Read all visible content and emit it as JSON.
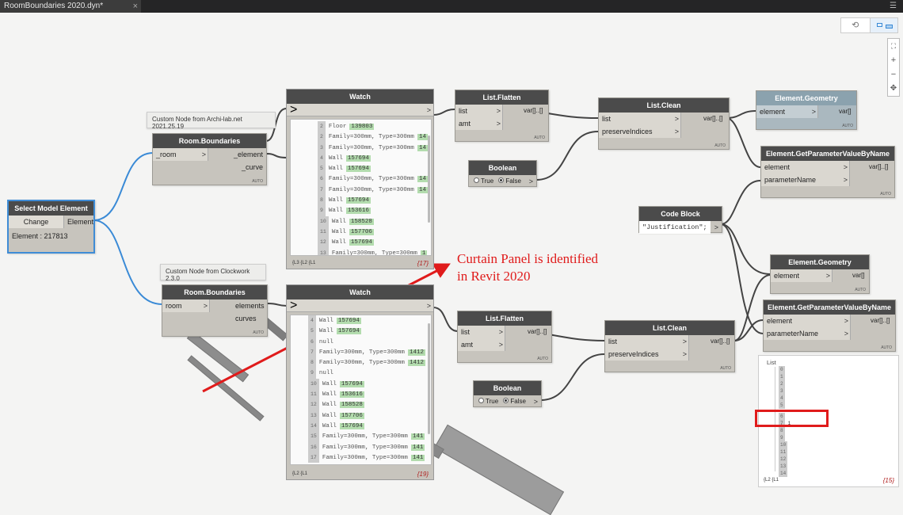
{
  "tab": {
    "title": "RoomBoundaries 2020.dyn*",
    "close": "×",
    "menu": "☰"
  },
  "controls": {
    "zoom_in": "+",
    "zoom_out": "−",
    "pan": "✥",
    "fit": "⛶",
    "geom_icon": "geometry-view-icon",
    "graph_icon": "graph-view-icon"
  },
  "tooltips": {
    "archilab": "Custom Node from Archi-lab.net 2021.25.19",
    "clockwork": "Custom Node from Clockwork 2.3.0"
  },
  "select_node": {
    "title": "Select Model Element",
    "change": "Change",
    "out": "Element",
    "value": "Element : 217813"
  },
  "rb1": {
    "title": "Room.Boundaries",
    "in": "_room",
    "out1": "_element",
    "out2": "_curve",
    "auto": "AUTO"
  },
  "rb2": {
    "title": "Room.Boundaries",
    "in": "room",
    "out1": "elements",
    "out2": "curves",
    "auto": "AUTO"
  },
  "watch1": {
    "title": "Watch",
    "in": ">",
    "out": ">",
    "footer": "{L3 {L2 {L1",
    "count": "{17}",
    "rows": [
      {
        "i": "2",
        "t": "Floor",
        "v": "139803"
      },
      {
        "i": "2",
        "t": "Family=300mm, Type=300mm",
        "v": "14"
      },
      {
        "i": "3",
        "t": "Family=300mm, Type=300mm",
        "v": "14"
      },
      {
        "i": "4",
        "t": "Wall",
        "v": "157694"
      },
      {
        "i": "5",
        "t": "Wall",
        "v": "157694"
      },
      {
        "i": "6",
        "t": "Family=300mm, Type=300mm",
        "v": "14"
      },
      {
        "i": "7",
        "t": "Family=300mm, Type=300mm",
        "v": "14"
      },
      {
        "i": "8",
        "t": "Wall",
        "v": "157694"
      },
      {
        "i": "9",
        "t": "Wall",
        "v": "153616"
      },
      {
        "i": "10",
        "t": "Wall",
        "v": "158528"
      },
      {
        "i": "11",
        "t": "Wall",
        "v": "157706"
      },
      {
        "i": "12",
        "t": "Wall",
        "v": "157694"
      },
      {
        "i": "13",
        "t": "Family=300mm, Type=300mm",
        "v": "1"
      }
    ]
  },
  "watch2": {
    "title": "Watch",
    "in": ">",
    "out": ">",
    "footer": "{L2 {L1",
    "count": "{19}",
    "rows": [
      {
        "i": "4",
        "t": "Wall",
        "v": "157694"
      },
      {
        "i": "5",
        "t": "Wall",
        "v": "157694"
      },
      {
        "i": "6",
        "t": "null",
        "v": ""
      },
      {
        "i": "7",
        "t": "Family=300mm, Type=300mm",
        "v": "1412"
      },
      {
        "i": "8",
        "t": "Family=300mm, Type=300mm",
        "v": "1412"
      },
      {
        "i": "9",
        "t": "null",
        "v": ""
      },
      {
        "i": "10",
        "t": "Wall",
        "v": "157694"
      },
      {
        "i": "11",
        "t": "Wall",
        "v": "153616"
      },
      {
        "i": "12",
        "t": "Wall",
        "v": "158528"
      },
      {
        "i": "13",
        "t": "Wall",
        "v": "157706"
      },
      {
        "i": "14",
        "t": "Wall",
        "v": "157694"
      },
      {
        "i": "15",
        "t": "Family=300mm, Type=300mm",
        "v": "141"
      },
      {
        "i": "16",
        "t": "Family=300mm, Type=300mm",
        "v": "141"
      },
      {
        "i": "17",
        "t": "Family=300mm, Type=300mm",
        "v": "141"
      }
    ]
  },
  "flatten1": {
    "title": "List.Flatten",
    "in1": "list",
    "in2": "amt",
    "out": "var[]..[]",
    "auto": "AUTO"
  },
  "flatten2": {
    "title": "List.Flatten",
    "in1": "list",
    "in2": "amt",
    "out": "var[]..[]",
    "auto": "AUTO"
  },
  "bool1": {
    "title": "Boolean",
    "t": "True",
    "f": "False",
    "out": ">"
  },
  "bool2": {
    "title": "Boolean",
    "t": "True",
    "f": "False",
    "out": ">"
  },
  "clean1": {
    "title": "List.Clean",
    "in1": "list",
    "in2": "preserveIndices",
    "out": "var[]..[]",
    "auto": "AUTO"
  },
  "clean2": {
    "title": "List.Clean",
    "in1": "list",
    "in2": "preserveIndices",
    "out": "var[]..[]",
    "auto": "AUTO"
  },
  "geom1": {
    "title": "Element.Geometry",
    "in": "element",
    "out": "var[]",
    "auto": "AUTO"
  },
  "geom2": {
    "title": "Element.Geometry",
    "in": "element",
    "out": "var[]",
    "auto": "AUTO"
  },
  "gp1": {
    "title": "Element.GetParameterValueByName",
    "in1": "element",
    "in2": "parameterName",
    "out": "var[]..[]",
    "auto": "AUTO"
  },
  "gp2": {
    "title": "Element.GetParameterValueByName",
    "in1": "element",
    "in2": "parameterName",
    "out": "var[]..[]",
    "auto": "AUTO"
  },
  "code": {
    "title": "Code Block",
    "value": "\"Justification\";",
    "out": ">"
  },
  "listpreview": {
    "head": "List",
    "rows": [
      "0",
      "1",
      "2",
      "3",
      "4",
      "5",
      "6",
      "7",
      "8",
      "9",
      "10",
      "11",
      "12",
      "13",
      "14"
    ],
    "hl_val": "1",
    "footer": "{L2 {L1",
    "count": "{15}"
  },
  "annotation": {
    "line1": "Curtain Panel is identified",
    "line2": "in Revit 2020",
    "color": "#e01b1b"
  }
}
